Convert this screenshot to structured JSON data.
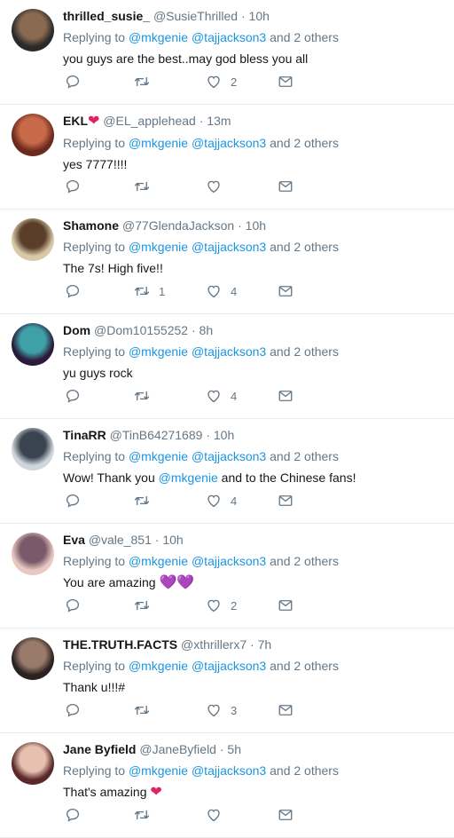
{
  "tweets": [
    {
      "name": "thrilled_susie_",
      "badge": "",
      "handle": "@SusieThrilled",
      "sep": "·",
      "time": "10h",
      "reply_prefix": "Replying to",
      "mention1": "@mkgenie",
      "mention2": "@tajjackson3",
      "reply_suffix": "and 2 others",
      "text": "you guys are the best..may god bless you all",
      "text_link": "",
      "text_after": "",
      "emoji": "",
      "retweets": "",
      "likes": "2",
      "avatar_colors": [
        "#2a2a2a",
        "#8a6a50"
      ]
    },
    {
      "name": "EKL",
      "badge": "❤",
      "handle": "@EL_applehead",
      "sep": "·",
      "time": "13m",
      "reply_prefix": "Replying to",
      "mention1": "@mkgenie",
      "mention2": "@tajjackson3",
      "reply_suffix": "and 2 others",
      "text": "yes 7777!!!!",
      "text_link": "",
      "text_after": "",
      "emoji": "",
      "retweets": "",
      "likes": "",
      "avatar_colors": [
        "#6b2a1e",
        "#c86a4a"
      ]
    },
    {
      "name": "Shamone",
      "badge": "",
      "handle": "@77GlendaJackson",
      "sep": "·",
      "time": "10h",
      "reply_prefix": "Replying to",
      "mention1": "@mkgenie",
      "mention2": "@tajjackson3",
      "reply_suffix": "and 2 others",
      "text": "The 7s! High five!!",
      "text_link": "",
      "text_after": "",
      "emoji": "",
      "retweets": "1",
      "likes": "4",
      "avatar_colors": [
        "#d9c9a8",
        "#5a3e2a"
      ]
    },
    {
      "name": "Dom",
      "badge": "",
      "handle": "@Dom10155252",
      "sep": "·",
      "time": "8h",
      "reply_prefix": "Replying to",
      "mention1": "@mkgenie",
      "mention2": "@tajjackson3",
      "reply_suffix": "and 2 others",
      "text": "yu guys rock",
      "text_link": "",
      "text_after": "",
      "emoji": "",
      "retweets": "",
      "likes": "4",
      "avatar_colors": [
        "#2b1a3a",
        "#3fa0a8"
      ]
    },
    {
      "name": "TinaRR",
      "badge": "",
      "handle": "@TinB64271689",
      "sep": "·",
      "time": "10h",
      "reply_prefix": "Replying to",
      "mention1": "@mkgenie",
      "mention2": "@tajjackson3",
      "reply_suffix": "and 2 others",
      "text": "Wow! Thank you ",
      "text_link": "@mkgenie",
      "text_after": " and to the Chinese fans!",
      "emoji": "",
      "retweets": "",
      "likes": "4",
      "avatar_colors": [
        "#cfd6dc",
        "#3a4450"
      ]
    },
    {
      "name": "Eva",
      "badge": "",
      "handle": "@vale_851",
      "sep": "·",
      "time": "10h",
      "reply_prefix": "Replying to",
      "mention1": "@mkgenie",
      "mention2": "@tajjackson3",
      "reply_suffix": "and 2 others",
      "text": "You are amazing ",
      "text_link": "",
      "text_after": "",
      "emoji": "💜💜",
      "retweets": "",
      "likes": "2",
      "avatar_colors": [
        "#e8c8c0",
        "#7a5a6a"
      ]
    },
    {
      "name": "THE.TRUTH.FACTS",
      "badge": "",
      "handle": "@xthrillerx7",
      "sep": "·",
      "time": "7h",
      "reply_prefix": "Replying to",
      "mention1": "@mkgenie",
      "mention2": "@tajjackson3",
      "reply_suffix": "and 2 others",
      "text": "Thank u!!!#",
      "text_link": "",
      "text_after": "",
      "emoji": "",
      "retweets": "",
      "likes": "3",
      "avatar_colors": [
        "#2a2220",
        "#9a7a6a"
      ]
    },
    {
      "name": "Jane Byfield",
      "badge": "",
      "handle": "@JaneByfield",
      "sep": "·",
      "time": "5h",
      "reply_prefix": "Replying to",
      "mention1": "@mkgenie",
      "mention2": "@tajjackson3",
      "reply_suffix": "and 2 others",
      "text": "That's amazing ",
      "text_link": "",
      "text_after": "",
      "emoji": "❤",
      "retweets": "",
      "likes": "",
      "avatar_colors": [
        "#5a2a2a",
        "#e8c0b0"
      ]
    }
  ],
  "colors": {
    "link": "#1b95e0",
    "muted": "#657786",
    "text": "#14171a",
    "divider": "#e6ecf0",
    "heart": "#e0245e",
    "purple_heart": "#9b7fd6"
  },
  "icons": [
    "reply-icon",
    "retweet-icon",
    "like-icon",
    "direct-message-icon"
  ]
}
